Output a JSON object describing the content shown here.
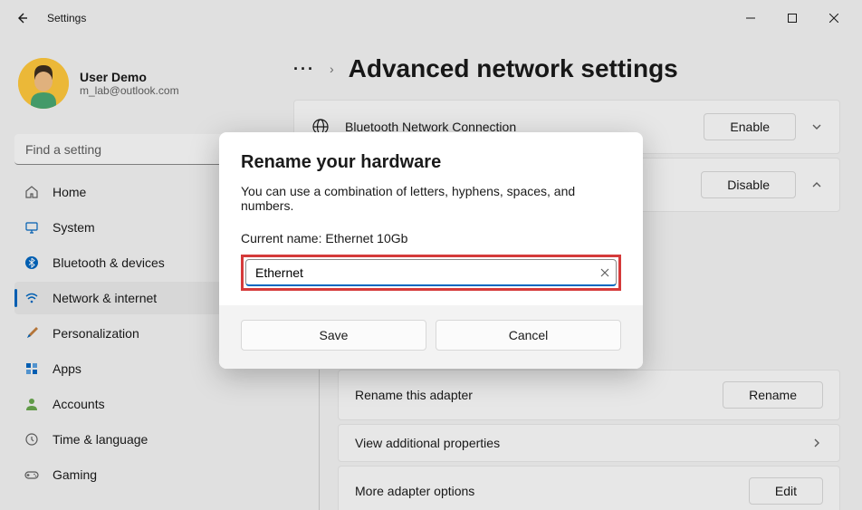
{
  "window": {
    "title": "Settings"
  },
  "user": {
    "name": "User Demo",
    "email": "m_lab@outlook.com"
  },
  "search": {
    "placeholder": "Find a setting"
  },
  "nav": {
    "items": [
      {
        "label": "Home"
      },
      {
        "label": "System"
      },
      {
        "label": "Bluetooth & devices"
      },
      {
        "label": "Network & internet"
      },
      {
        "label": "Personalization"
      },
      {
        "label": "Apps"
      },
      {
        "label": "Accounts"
      },
      {
        "label": "Time & language"
      },
      {
        "label": "Gaming"
      }
    ]
  },
  "page": {
    "title": "Advanced network settings",
    "cards": [
      {
        "title": "Bluetooth Network Connection",
        "button": "Enable"
      },
      {
        "title": "",
        "button": "Disable"
      }
    ],
    "sub_rows": [
      {
        "label": "Rename this adapter",
        "button": "Rename"
      },
      {
        "label": "View additional properties"
      },
      {
        "label": "More adapter options",
        "button": "Edit"
      }
    ]
  },
  "dialog": {
    "title": "Rename your hardware",
    "desc": "You can use a combination of letters, hyphens, spaces, and numbers.",
    "current_label": "Current name: Ethernet 10Gb",
    "input_value": "Ethernet",
    "save": "Save",
    "cancel": "Cancel"
  }
}
